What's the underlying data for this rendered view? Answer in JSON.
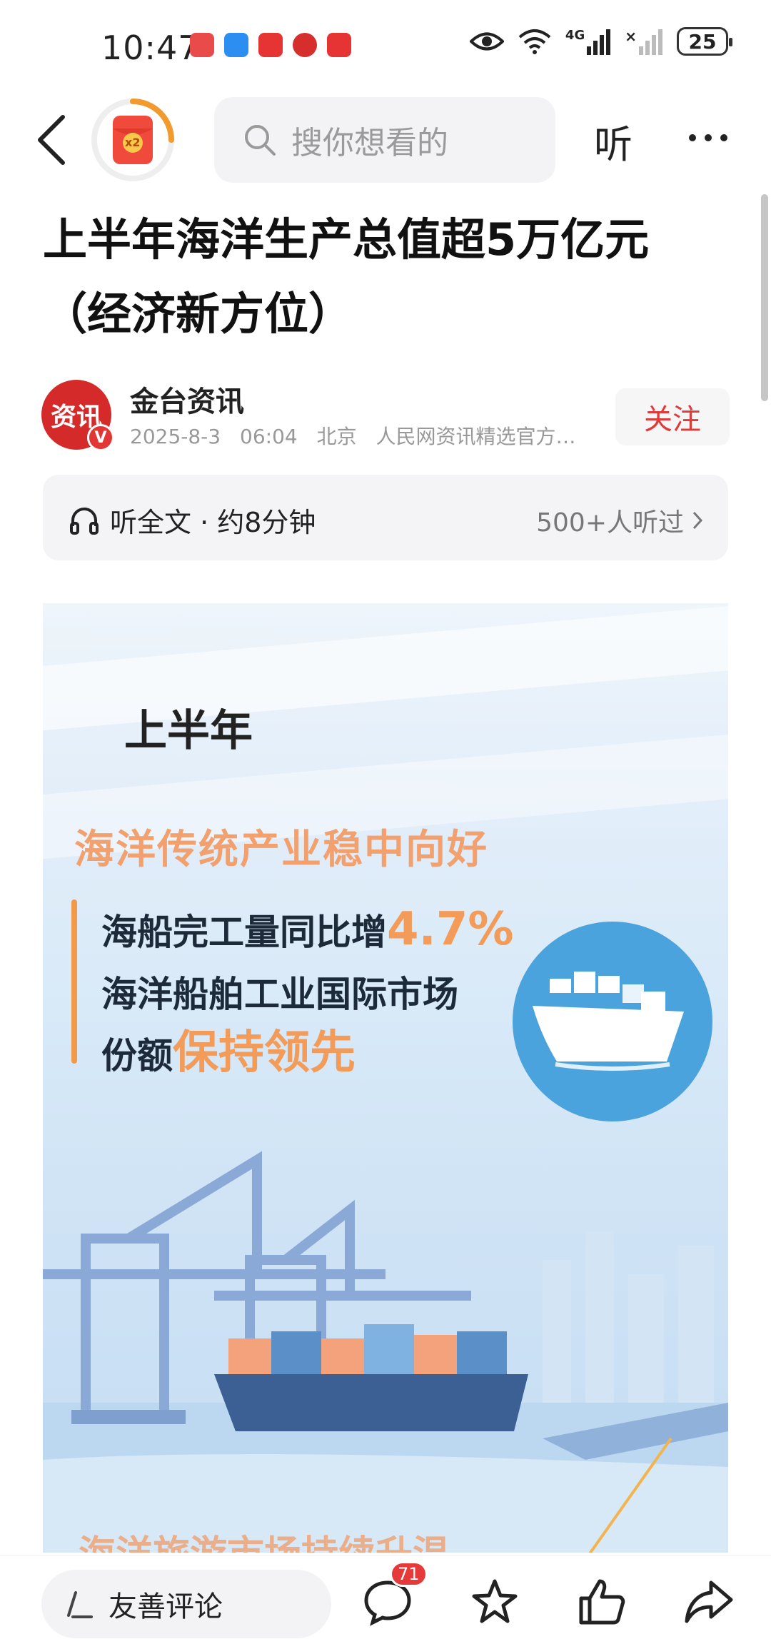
{
  "status_bar": {
    "time": "10:47",
    "network": "4G",
    "battery": "25"
  },
  "nav": {
    "badge_text": "x2",
    "search_placeholder": "搜你想看的",
    "listen_label": "听"
  },
  "article": {
    "title": "上半年海洋生产总值超5万亿元（经济新方位）",
    "author": {
      "avatar_text": "资讯",
      "name": "金台资讯",
      "date": "2025-8-3",
      "time": "06:04",
      "location": "北京",
      "source": "人民网资讯精选官方…",
      "follow_label": "关注"
    },
    "audio": {
      "label": "听全文 · 约8分钟",
      "listeners": "500+人听过"
    },
    "infographic": {
      "heading": "上半年",
      "subheading": "海洋传统产业稳中向好",
      "line1_text": "海船完工量同比增",
      "line1_value": "4.7%",
      "line2_text": "海洋船舶工业国际市场",
      "line3_text": "份额",
      "line3_highlight": "保持领先",
      "next_subheading": "海洋旅游市场持续升温"
    }
  },
  "bottom_bar": {
    "comment_placeholder": "友善评论",
    "comment_count": "71"
  },
  "colors": {
    "accent_red": "#e03a3a",
    "highlight_orange": "#f39c5a",
    "circle_blue": "#4aa3dc"
  }
}
